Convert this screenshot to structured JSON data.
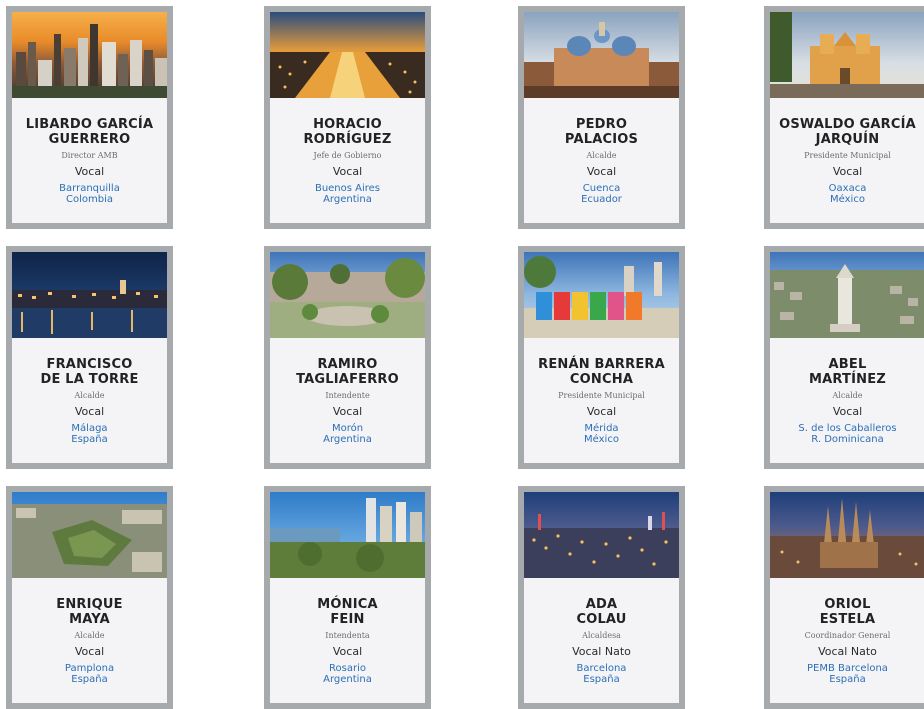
{
  "cards": [
    {
      "name_line1": "LIBARDO GARCÍA",
      "name_line2": "GUERRERO",
      "role": "Director AMB",
      "vocal": "Vocal",
      "city": "Barranquilla",
      "country": "Colombia",
      "image": "city-skyline-sunset"
    },
    {
      "name_line1": "HORACIO",
      "name_line2": "RODRÍGUEZ",
      "role": "Jefe de Gobierno",
      "vocal": "Vocal",
      "city": "Buenos Aires",
      "country": "Argentina",
      "image": "city-avenue-night"
    },
    {
      "name_line1": "PEDRO",
      "name_line2": "PALACIOS",
      "role": "Alcalde",
      "vocal": "Vocal",
      "city": "Cuenca",
      "country": "Ecuador",
      "image": "cathedral-domes"
    },
    {
      "name_line1": "OSWALDO GARCÍA",
      "name_line2": "JARQUÍN",
      "role": "Presidente Municipal",
      "vocal": "Vocal",
      "city": "Oaxaca",
      "country": "México",
      "image": "church-facade"
    },
    {
      "name_line1": "FRANCISCO",
      "name_line2": "DE LA TORRE",
      "role": "Alcalde",
      "vocal": "Vocal",
      "city": "Málaga",
      "country": "España",
      "image": "waterfront-night"
    },
    {
      "name_line1": "RAMIRO",
      "name_line2": "TAGLIAFERRO",
      "role": "Intendente",
      "vocal": "Vocal",
      "city": "Morón",
      "country": "Argentina",
      "image": "town-plaza"
    },
    {
      "name_line1": "RENÁN BARRERA",
      "name_line2": "CONCHA",
      "role": "Presidente Municipal",
      "vocal": "Vocal",
      "city": "Mérida",
      "country": "México",
      "image": "merida-letters"
    },
    {
      "name_line1": "ABEL",
      "name_line2": "MARTÍNEZ",
      "role": "Alcalde",
      "vocal": "Vocal",
      "city": "S. de los Caballeros",
      "country": "R. Dominicana",
      "image": "monument-city"
    },
    {
      "name_line1": "ENRIQUE",
      "name_line2": "MAYA",
      "role": "Alcalde",
      "vocal": "Vocal",
      "city": "Pamplona",
      "country": "España",
      "image": "aerial-citadel"
    },
    {
      "name_line1": "MÓNICA",
      "name_line2": "FEIN",
      "role": "Intendenta",
      "vocal": "Vocal",
      "city": "Rosario",
      "country": "Argentina",
      "image": "riverside-towers"
    },
    {
      "name_line1": "ADA",
      "name_line2": "COLAU",
      "role": "Alcaldesa",
      "vocal": "Vocal Nato",
      "city": "Barcelona",
      "country": "España",
      "image": "city-lights-twilight"
    },
    {
      "name_line1": "ORIOL",
      "name_line2": "ESTELA",
      "role": "Coordinador General",
      "vocal": "Vocal Nato",
      "city": "PEMB Barcelona",
      "country": "España",
      "image": "sagrada-familia"
    }
  ]
}
